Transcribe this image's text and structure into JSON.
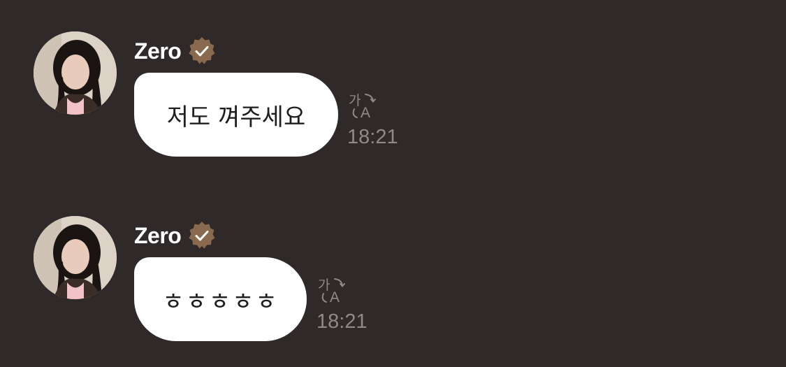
{
  "colors": {
    "background": "#2f2a29",
    "bubble": "#ffffff",
    "badge": "#8a6a4e",
    "timestamp": "#8f8a88"
  },
  "messages": [
    {
      "sender": "Zero",
      "verified": true,
      "avatar_icon": "profile-photo",
      "text": "저도 껴주세요",
      "translate_icon": "translate-icon",
      "translate_glyph_ko": "가",
      "translate_glyph_en": "A",
      "time": "18:21"
    },
    {
      "sender": "Zero",
      "verified": true,
      "avatar_icon": "profile-photo",
      "text": "ㅎㅎㅎㅎㅎ",
      "translate_icon": "translate-icon",
      "translate_glyph_ko": "가",
      "translate_glyph_en": "A",
      "time": "18:21"
    }
  ]
}
